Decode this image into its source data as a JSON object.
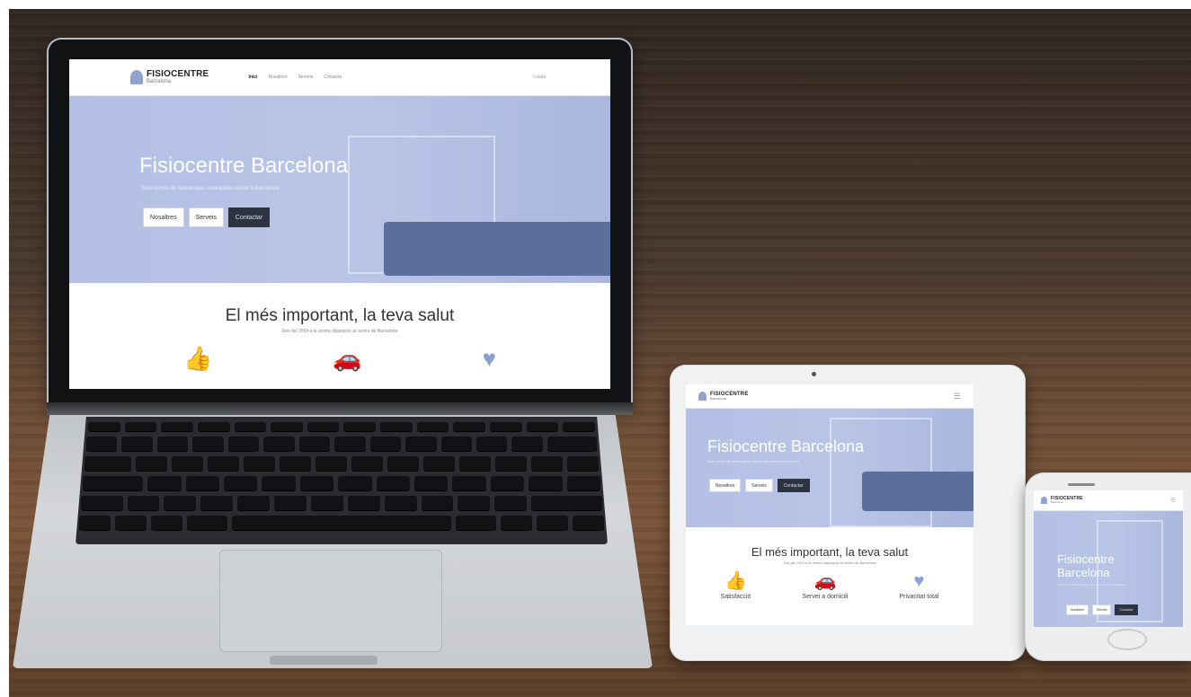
{
  "site": {
    "logo_text": "FISIOCENTRE",
    "logo_sub": "Barcelona",
    "nav": [
      "Inici",
      "Nosaltres",
      "Serveis",
      "Contacte"
    ],
    "nav_right": "Català",
    "hero_title": "Fisiocentre Barcelona",
    "hero_sub": "Som centre de fisioteràpia i osteopatia ubicat a Barcelona",
    "buttons": [
      "Nosaltres",
      "Serveis",
      "Contactar"
    ],
    "section_title": "El més important, la teva salut",
    "section_sub": "Des del 2004 a la vostra disposició al centre de Barcelona",
    "features": [
      {
        "icon": "thumbs-up-icon",
        "glyph": "👍",
        "label": "Satisfacció"
      },
      {
        "icon": "car-icon",
        "glyph": "🚗",
        "label": "Servei a domicili"
      },
      {
        "icon": "heart-jar-icon",
        "glyph": "♥",
        "label": "Privacitat total"
      }
    ],
    "menu_glyph": "☰"
  },
  "colors": {
    "hero": "#b3c0e4",
    "accent": "#8ea3cf",
    "dark_button": "#2d3440"
  }
}
